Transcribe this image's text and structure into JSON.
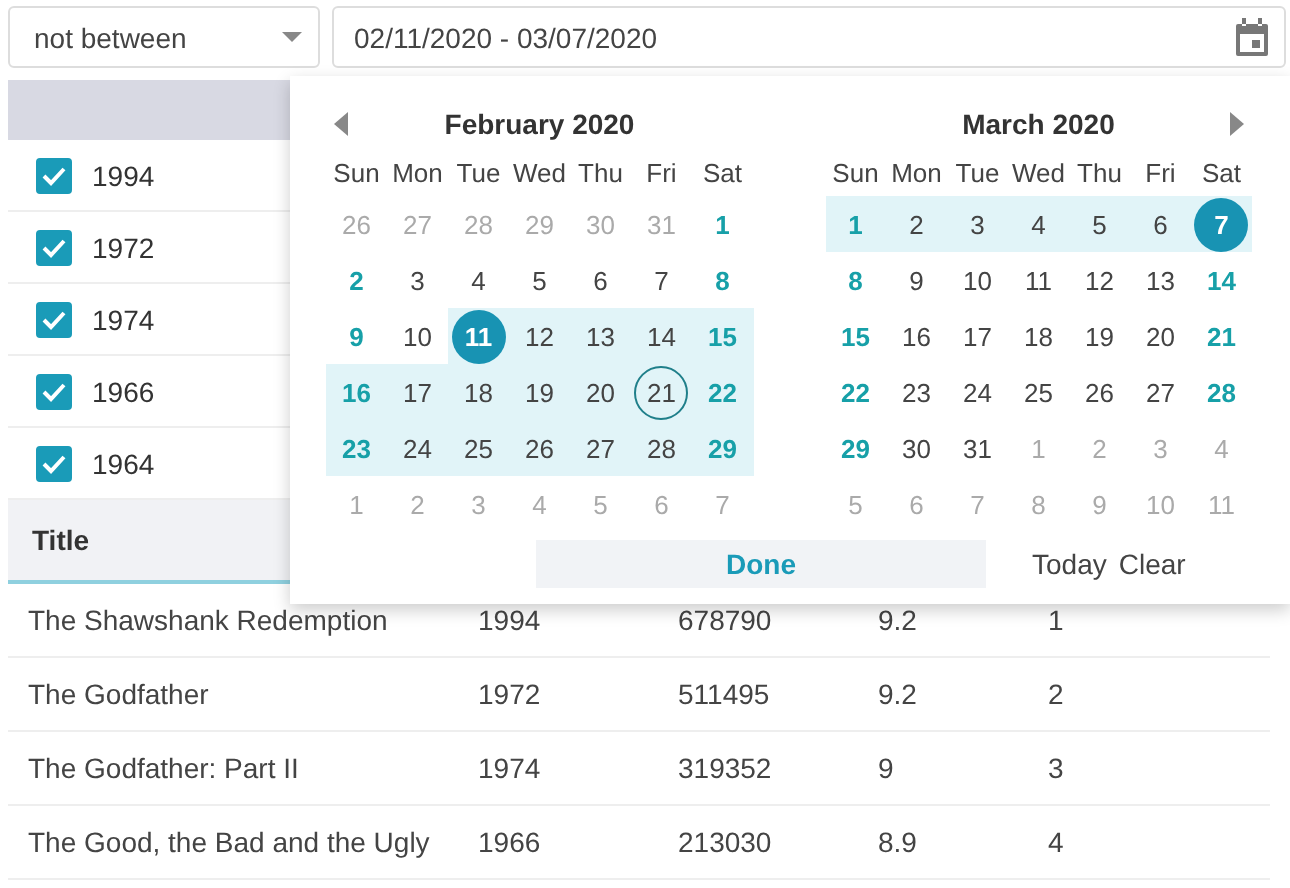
{
  "filter": {
    "operator": "not between",
    "range": "02/11/2020 - 03/07/2020"
  },
  "year_list": [
    {
      "label": "1994",
      "checked": true
    },
    {
      "label": "1972",
      "checked": true
    },
    {
      "label": "1974",
      "checked": true
    },
    {
      "label": "1966",
      "checked": true
    },
    {
      "label": "1964",
      "checked": true
    }
  ],
  "table": {
    "columns": [
      "Title"
    ],
    "rows": [
      {
        "cells": [
          "The Shawshank Redemption",
          "1994",
          "678790",
          "9.2",
          "1"
        ]
      },
      {
        "cells": [
          "The Godfather",
          "1972",
          "511495",
          "9.2",
          "2"
        ]
      },
      {
        "cells": [
          "The Godfather: Part II",
          "1974",
          "319352",
          "9",
          "3"
        ]
      },
      {
        "cells": [
          "The Good, the Bad and the Ugly",
          "1966",
          "213030",
          "8.9",
          "4"
        ]
      }
    ]
  },
  "calendar": {
    "months": [
      {
        "title": "February 2020",
        "weekdays": [
          "Sun",
          "Mon",
          "Tue",
          "Wed",
          "Thu",
          "Fri",
          "Sat"
        ],
        "weeks": [
          [
            {
              "t": "26",
              "kind": "other",
              "range": false,
              "selected": false,
              "today": false
            },
            {
              "t": "27",
              "kind": "other",
              "range": false,
              "selected": false,
              "today": false
            },
            {
              "t": "28",
              "kind": "other",
              "range": false,
              "selected": false,
              "today": false
            },
            {
              "t": "29",
              "kind": "other",
              "range": false,
              "selected": false,
              "today": false
            },
            {
              "t": "30",
              "kind": "other",
              "range": false,
              "selected": false,
              "today": false
            },
            {
              "t": "31",
              "kind": "other",
              "range": false,
              "selected": false,
              "today": false
            },
            {
              "t": "1",
              "kind": "weekend",
              "range": false,
              "selected": false,
              "today": false
            }
          ],
          [
            {
              "t": "2",
              "kind": "weekend",
              "range": false,
              "selected": false,
              "today": false
            },
            {
              "t": "3",
              "kind": "day",
              "range": false,
              "selected": false,
              "today": false
            },
            {
              "t": "4",
              "kind": "day",
              "range": false,
              "selected": false,
              "today": false
            },
            {
              "t": "5",
              "kind": "day",
              "range": false,
              "selected": false,
              "today": false
            },
            {
              "t": "6",
              "kind": "day",
              "range": false,
              "selected": false,
              "today": false
            },
            {
              "t": "7",
              "kind": "day",
              "range": false,
              "selected": false,
              "today": false
            },
            {
              "t": "8",
              "kind": "weekend",
              "range": false,
              "selected": false,
              "today": false
            }
          ],
          [
            {
              "t": "9",
              "kind": "weekend",
              "range": false,
              "selected": false,
              "today": false
            },
            {
              "t": "10",
              "kind": "day",
              "range": false,
              "selected": false,
              "today": false
            },
            {
              "t": "11",
              "kind": "day",
              "range": true,
              "selected": true,
              "today": false
            },
            {
              "t": "12",
              "kind": "day",
              "range": true,
              "selected": false,
              "today": false
            },
            {
              "t": "13",
              "kind": "day",
              "range": true,
              "selected": false,
              "today": false
            },
            {
              "t": "14",
              "kind": "day",
              "range": true,
              "selected": false,
              "today": false
            },
            {
              "t": "15",
              "kind": "weekend",
              "range": true,
              "selected": false,
              "today": false
            }
          ],
          [
            {
              "t": "16",
              "kind": "weekend",
              "range": true,
              "selected": false,
              "today": false
            },
            {
              "t": "17",
              "kind": "day",
              "range": true,
              "selected": false,
              "today": false
            },
            {
              "t": "18",
              "kind": "day",
              "range": true,
              "selected": false,
              "today": false
            },
            {
              "t": "19",
              "kind": "day",
              "range": true,
              "selected": false,
              "today": false
            },
            {
              "t": "20",
              "kind": "day",
              "range": true,
              "selected": false,
              "today": false
            },
            {
              "t": "21",
              "kind": "day",
              "range": true,
              "selected": false,
              "today": true
            },
            {
              "t": "22",
              "kind": "weekend",
              "range": true,
              "selected": false,
              "today": false
            }
          ],
          [
            {
              "t": "23",
              "kind": "weekend",
              "range": true,
              "selected": false,
              "today": false
            },
            {
              "t": "24",
              "kind": "day",
              "range": true,
              "selected": false,
              "today": false
            },
            {
              "t": "25",
              "kind": "day",
              "range": true,
              "selected": false,
              "today": false
            },
            {
              "t": "26",
              "kind": "day",
              "range": true,
              "selected": false,
              "today": false
            },
            {
              "t": "27",
              "kind": "day",
              "range": true,
              "selected": false,
              "today": false
            },
            {
              "t": "28",
              "kind": "day",
              "range": true,
              "selected": false,
              "today": false
            },
            {
              "t": "29",
              "kind": "weekend",
              "range": true,
              "selected": false,
              "today": false
            }
          ],
          [
            {
              "t": "1",
              "kind": "other",
              "range": false,
              "selected": false,
              "today": false
            },
            {
              "t": "2",
              "kind": "other",
              "range": false,
              "selected": false,
              "today": false
            },
            {
              "t": "3",
              "kind": "other",
              "range": false,
              "selected": false,
              "today": false
            },
            {
              "t": "4",
              "kind": "other",
              "range": false,
              "selected": false,
              "today": false
            },
            {
              "t": "5",
              "kind": "other",
              "range": false,
              "selected": false,
              "today": false
            },
            {
              "t": "6",
              "kind": "other",
              "range": false,
              "selected": false,
              "today": false
            },
            {
              "t": "7",
              "kind": "other",
              "range": false,
              "selected": false,
              "today": false
            }
          ]
        ]
      },
      {
        "title": "March 2020",
        "weekdays": [
          "Sun",
          "Mon",
          "Tue",
          "Wed",
          "Thu",
          "Fri",
          "Sat"
        ],
        "weeks": [
          [
            {
              "t": "1",
              "kind": "weekend",
              "range": true,
              "selected": false,
              "today": false
            },
            {
              "t": "2",
              "kind": "day",
              "range": true,
              "selected": false,
              "today": false
            },
            {
              "t": "3",
              "kind": "day",
              "range": true,
              "selected": false,
              "today": false
            },
            {
              "t": "4",
              "kind": "day",
              "range": true,
              "selected": false,
              "today": false
            },
            {
              "t": "5",
              "kind": "day",
              "range": true,
              "selected": false,
              "today": false
            },
            {
              "t": "6",
              "kind": "day",
              "range": true,
              "selected": false,
              "today": false
            },
            {
              "t": "7",
              "kind": "weekend",
              "range": true,
              "selected": true,
              "today": false
            }
          ],
          [
            {
              "t": "8",
              "kind": "weekend",
              "range": false,
              "selected": false,
              "today": false
            },
            {
              "t": "9",
              "kind": "day",
              "range": false,
              "selected": false,
              "today": false
            },
            {
              "t": "10",
              "kind": "day",
              "range": false,
              "selected": false,
              "today": false
            },
            {
              "t": "11",
              "kind": "day",
              "range": false,
              "selected": false,
              "today": false
            },
            {
              "t": "12",
              "kind": "day",
              "range": false,
              "selected": false,
              "today": false
            },
            {
              "t": "13",
              "kind": "day",
              "range": false,
              "selected": false,
              "today": false
            },
            {
              "t": "14",
              "kind": "weekend",
              "range": false,
              "selected": false,
              "today": false
            }
          ],
          [
            {
              "t": "15",
              "kind": "weekend",
              "range": false,
              "selected": false,
              "today": false
            },
            {
              "t": "16",
              "kind": "day",
              "range": false,
              "selected": false,
              "today": false
            },
            {
              "t": "17",
              "kind": "day",
              "range": false,
              "selected": false,
              "today": false
            },
            {
              "t": "18",
              "kind": "day",
              "range": false,
              "selected": false,
              "today": false
            },
            {
              "t": "19",
              "kind": "day",
              "range": false,
              "selected": false,
              "today": false
            },
            {
              "t": "20",
              "kind": "day",
              "range": false,
              "selected": false,
              "today": false
            },
            {
              "t": "21",
              "kind": "weekend",
              "range": false,
              "selected": false,
              "today": false
            }
          ],
          [
            {
              "t": "22",
              "kind": "weekend",
              "range": false,
              "selected": false,
              "today": false
            },
            {
              "t": "23",
              "kind": "day",
              "range": false,
              "selected": false,
              "today": false
            },
            {
              "t": "24",
              "kind": "day",
              "range": false,
              "selected": false,
              "today": false
            },
            {
              "t": "25",
              "kind": "day",
              "range": false,
              "selected": false,
              "today": false
            },
            {
              "t": "26",
              "kind": "day",
              "range": false,
              "selected": false,
              "today": false
            },
            {
              "t": "27",
              "kind": "day",
              "range": false,
              "selected": false,
              "today": false
            },
            {
              "t": "28",
              "kind": "weekend",
              "range": false,
              "selected": false,
              "today": false
            }
          ],
          [
            {
              "t": "29",
              "kind": "weekend",
              "range": false,
              "selected": false,
              "today": false
            },
            {
              "t": "30",
              "kind": "day",
              "range": false,
              "selected": false,
              "today": false
            },
            {
              "t": "31",
              "kind": "day",
              "range": false,
              "selected": false,
              "today": false
            },
            {
              "t": "1",
              "kind": "other",
              "range": false,
              "selected": false,
              "today": false
            },
            {
              "t": "2",
              "kind": "other",
              "range": false,
              "selected": false,
              "today": false
            },
            {
              "t": "3",
              "kind": "other",
              "range": false,
              "selected": false,
              "today": false
            },
            {
              "t": "4",
              "kind": "other",
              "range": false,
              "selected": false,
              "today": false
            }
          ],
          [
            {
              "t": "5",
              "kind": "other",
              "range": false,
              "selected": false,
              "today": false
            },
            {
              "t": "6",
              "kind": "other",
              "range": false,
              "selected": false,
              "today": false
            },
            {
              "t": "7",
              "kind": "other",
              "range": false,
              "selected": false,
              "today": false
            },
            {
              "t": "8",
              "kind": "other",
              "range": false,
              "selected": false,
              "today": false
            },
            {
              "t": "9",
              "kind": "other",
              "range": false,
              "selected": false,
              "today": false
            },
            {
              "t": "10",
              "kind": "other",
              "range": false,
              "selected": false,
              "today": false
            },
            {
              "t": "11",
              "kind": "other",
              "range": false,
              "selected": false,
              "today": false
            }
          ]
        ]
      }
    ],
    "done": "Done",
    "today": "Today",
    "clear": "Clear"
  }
}
